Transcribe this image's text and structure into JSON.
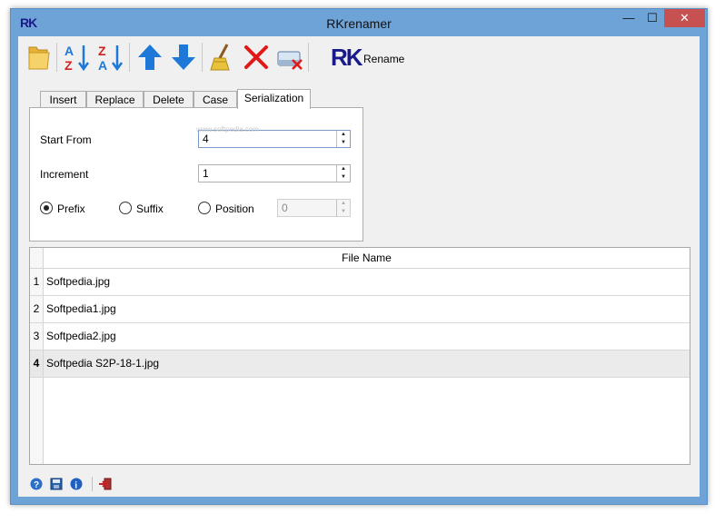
{
  "window": {
    "title": "RKrenamer",
    "app_icon_text": "RK",
    "minimize_glyph": "—",
    "maximize_glyph": "☐",
    "close_glyph": "✕"
  },
  "toolbar": {
    "buttons": [
      {
        "name": "open-folder",
        "icon": "folder-icon"
      },
      {
        "name": "sort-az",
        "icon": "sort-az-icon"
      },
      {
        "name": "sort-za",
        "icon": "sort-za-icon"
      },
      {
        "name": "move-up",
        "icon": "arrow-up-icon"
      },
      {
        "name": "move-down",
        "icon": "arrow-down-icon"
      },
      {
        "name": "clean",
        "icon": "broom-icon"
      },
      {
        "name": "remove",
        "icon": "red-x-icon"
      },
      {
        "name": "clear-list",
        "icon": "eraser-icon"
      }
    ],
    "rename_logo": "RK",
    "rename_label": "Rename"
  },
  "tabs": [
    "Insert",
    "Replace",
    "Delete",
    "Case",
    "Serialization"
  ],
  "active_tab": "Serialization",
  "serialization": {
    "start_from_label": "Start From",
    "start_from_value": "4",
    "increment_label": "Increment",
    "increment_value": "1",
    "options": [
      "Prefix",
      "Suffix",
      "Position"
    ],
    "selected_option": "Prefix",
    "position_value": "0"
  },
  "watermark": "www.softpedia.com",
  "file_grid": {
    "header": "File Name",
    "rows": [
      {
        "num": "1",
        "name": "Softpedia.jpg"
      },
      {
        "num": "2",
        "name": "Softpedia1.jpg"
      },
      {
        "num": "3",
        "name": "Softpedia2.jpg"
      },
      {
        "num": "4",
        "name": "Softpedia S2P-18-1.jpg"
      }
    ],
    "selected_row": 3
  },
  "statusbar": {
    "icons": [
      "help-icon",
      "save-settings-icon",
      "info-icon",
      "exit-icon"
    ]
  },
  "colors": {
    "frame": "#6ea3d8",
    "close_button": "#c75050",
    "arrow_blue": "#1e78d8",
    "delete_red": "#e01818",
    "logo_navy": "#1a1a8a"
  }
}
